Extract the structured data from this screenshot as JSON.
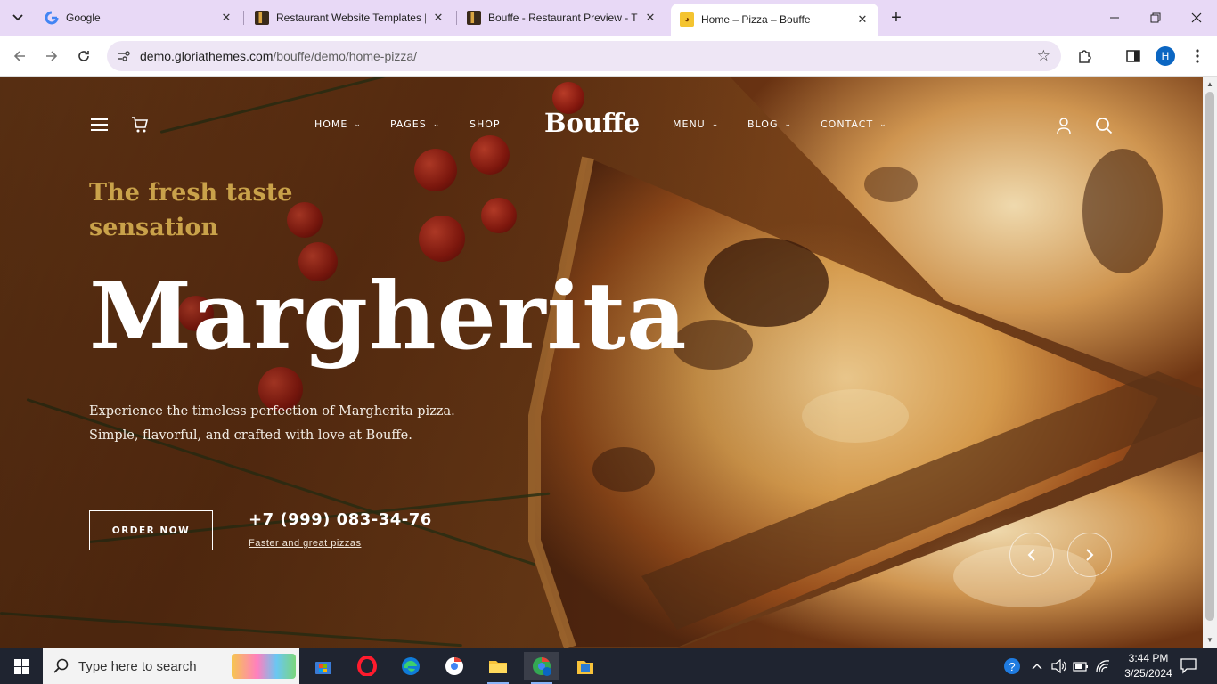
{
  "browser": {
    "tabs": [
      {
        "title": "Google",
        "active": false
      },
      {
        "title": "Restaurant Website Templates |",
        "active": false
      },
      {
        "title": "Bouffe - Restaurant Preview - Th",
        "active": false
      },
      {
        "title": "Home – Pizza – Bouffe",
        "active": true
      }
    ],
    "url_host": "demo.gloriathemes.com",
    "url_path": "/bouffe/demo/home-pizza/",
    "profile_initial": "H"
  },
  "site": {
    "brand": "Bouffe",
    "nav": {
      "home": "HOME",
      "pages": "PAGES",
      "shop": "SHOP",
      "menu": "MENU",
      "blog": "BLOG",
      "contact": "CONTACT"
    },
    "hero": {
      "tagline": "The fresh taste sensation",
      "headline": "Margherita",
      "description_line1": "Experience the timeless perfection of Margherita pizza.",
      "description_line2": "Simple, flavorful, and crafted with love at Bouffe.",
      "order_button": "ORDER NOW",
      "phone": "+7 (999) 083-34-76",
      "phone_note": "Faster and great pizzas"
    },
    "colors": {
      "tagline": "#c9a24a",
      "text": "#ffffff"
    }
  },
  "taskbar": {
    "search_placeholder": "Type here to search",
    "time": "3:44 PM",
    "date": "3/25/2024"
  }
}
